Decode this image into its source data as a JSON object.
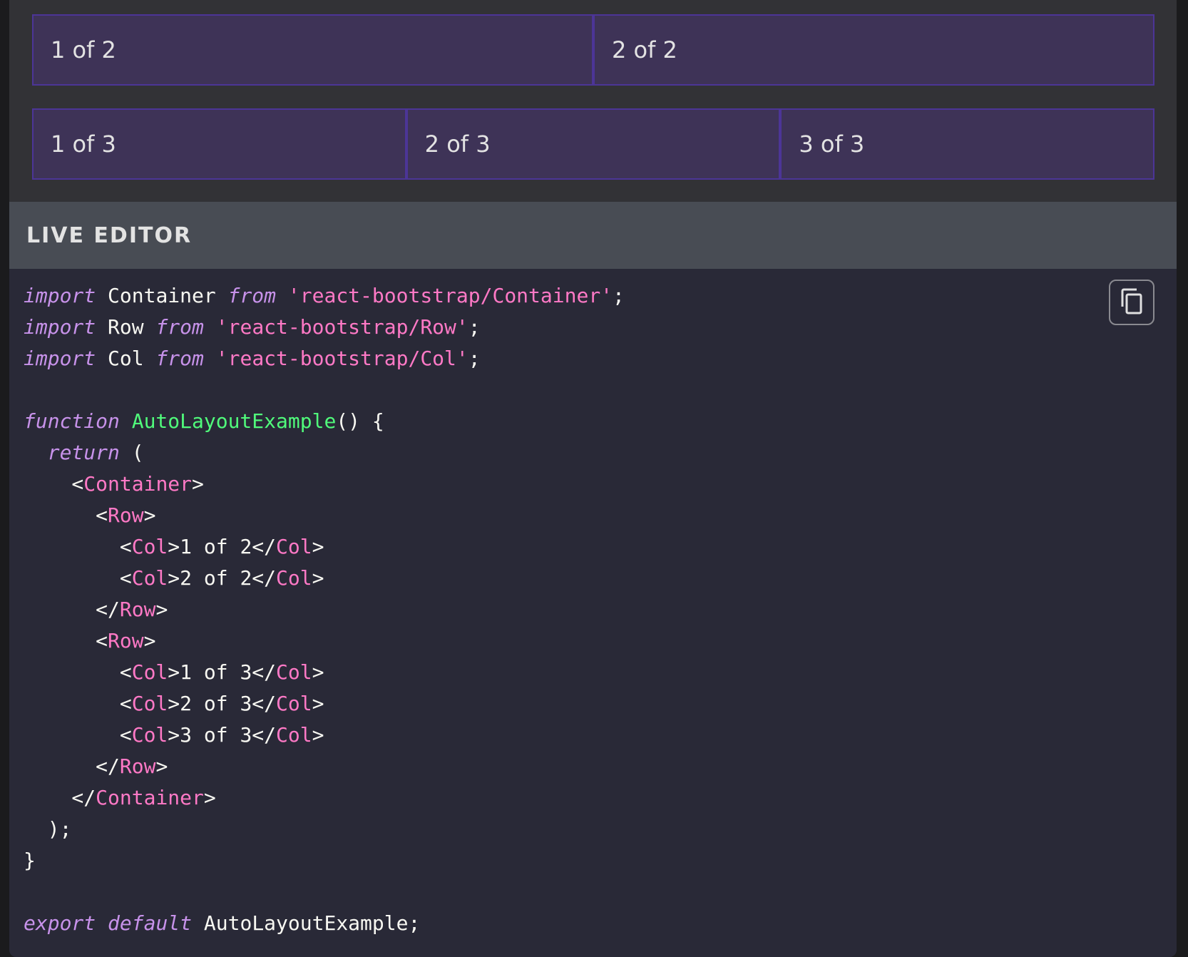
{
  "preview": {
    "rows": [
      {
        "cols": [
          "1 of 2",
          "2 of 2"
        ]
      },
      {
        "cols": [
          "1 of 3",
          "2 of 3",
          "3 of 3"
        ]
      }
    ]
  },
  "editor": {
    "title": "LIVE EDITOR",
    "copy_icon": "copy-icon",
    "code_lines": [
      [
        {
          "t": "kw",
          "v": "import"
        },
        {
          "t": "plain",
          "v": " Container "
        },
        {
          "t": "kw",
          "v": "from"
        },
        {
          "t": "plain",
          "v": " "
        },
        {
          "t": "str",
          "v": "'react-bootstrap/Container'"
        },
        {
          "t": "plain",
          "v": ";"
        }
      ],
      [
        {
          "t": "kw",
          "v": "import"
        },
        {
          "t": "plain",
          "v": " Row "
        },
        {
          "t": "kw",
          "v": "from"
        },
        {
          "t": "plain",
          "v": " "
        },
        {
          "t": "str",
          "v": "'react-bootstrap/Row'"
        },
        {
          "t": "plain",
          "v": ";"
        }
      ],
      [
        {
          "t": "kw",
          "v": "import"
        },
        {
          "t": "plain",
          "v": " Col "
        },
        {
          "t": "kw",
          "v": "from"
        },
        {
          "t": "plain",
          "v": " "
        },
        {
          "t": "str",
          "v": "'react-bootstrap/Col'"
        },
        {
          "t": "plain",
          "v": ";"
        }
      ],
      [],
      [
        {
          "t": "kw",
          "v": "function"
        },
        {
          "t": "plain",
          "v": " "
        },
        {
          "t": "fn",
          "v": "AutoLayoutExample"
        },
        {
          "t": "plain",
          "v": "() {"
        }
      ],
      [
        {
          "t": "plain",
          "v": "  "
        },
        {
          "t": "kw",
          "v": "return"
        },
        {
          "t": "plain",
          "v": " ("
        }
      ],
      [
        {
          "t": "plain",
          "v": "    <"
        },
        {
          "t": "tag",
          "v": "Container"
        },
        {
          "t": "plain",
          "v": ">"
        }
      ],
      [
        {
          "t": "plain",
          "v": "      <"
        },
        {
          "t": "tag",
          "v": "Row"
        },
        {
          "t": "plain",
          "v": ">"
        }
      ],
      [
        {
          "t": "plain",
          "v": "        <"
        },
        {
          "t": "tag",
          "v": "Col"
        },
        {
          "t": "plain",
          "v": ">1 of 2</"
        },
        {
          "t": "tag",
          "v": "Col"
        },
        {
          "t": "plain",
          "v": ">"
        }
      ],
      [
        {
          "t": "plain",
          "v": "        <"
        },
        {
          "t": "tag",
          "v": "Col"
        },
        {
          "t": "plain",
          "v": ">2 of 2</"
        },
        {
          "t": "tag",
          "v": "Col"
        },
        {
          "t": "plain",
          "v": ">"
        }
      ],
      [
        {
          "t": "plain",
          "v": "      </"
        },
        {
          "t": "tag",
          "v": "Row"
        },
        {
          "t": "plain",
          "v": ">"
        }
      ],
      [
        {
          "t": "plain",
          "v": "      <"
        },
        {
          "t": "tag",
          "v": "Row"
        },
        {
          "t": "plain",
          "v": ">"
        }
      ],
      [
        {
          "t": "plain",
          "v": "        <"
        },
        {
          "t": "tag",
          "v": "Col"
        },
        {
          "t": "plain",
          "v": ">1 of 3</"
        },
        {
          "t": "tag",
          "v": "Col"
        },
        {
          "t": "plain",
          "v": ">"
        }
      ],
      [
        {
          "t": "plain",
          "v": "        <"
        },
        {
          "t": "tag",
          "v": "Col"
        },
        {
          "t": "plain",
          "v": ">2 of 3</"
        },
        {
          "t": "tag",
          "v": "Col"
        },
        {
          "t": "plain",
          "v": ">"
        }
      ],
      [
        {
          "t": "plain",
          "v": "        <"
        },
        {
          "t": "tag",
          "v": "Col"
        },
        {
          "t": "plain",
          "v": ">3 of 3</"
        },
        {
          "t": "tag",
          "v": "Col"
        },
        {
          "t": "plain",
          "v": ">"
        }
      ],
      [
        {
          "t": "plain",
          "v": "      </"
        },
        {
          "t": "tag",
          "v": "Row"
        },
        {
          "t": "plain",
          "v": ">"
        }
      ],
      [
        {
          "t": "plain",
          "v": "    </"
        },
        {
          "t": "tag",
          "v": "Container"
        },
        {
          "t": "plain",
          "v": ">"
        }
      ],
      [
        {
          "t": "plain",
          "v": "  );"
        }
      ],
      [
        {
          "t": "plain",
          "v": "}"
        }
      ],
      [],
      [
        {
          "t": "kw",
          "v": "export"
        },
        {
          "t": "plain",
          "v": " "
        },
        {
          "t": "kw",
          "v": "default"
        },
        {
          "t": "plain",
          "v": " AutoLayoutExample;"
        }
      ]
    ]
  },
  "colors": {
    "preview_bg": "#323236",
    "col_bg": "#3e3357",
    "col_border": "#4c3597",
    "editor_header_bg": "#484c54",
    "code_bg": "#292937",
    "keyword": "#c792ea",
    "string": "#ff79c6",
    "function": "#50fa7b"
  }
}
